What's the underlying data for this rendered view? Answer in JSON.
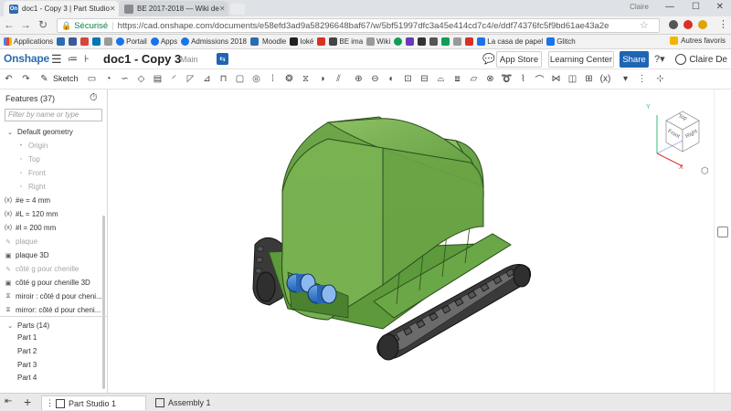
{
  "browser": {
    "tabs": [
      {
        "title": "doc1 - Copy 3 | Part Studio",
        "active": true
      },
      {
        "title": "BE 2017-2018 — Wiki de",
        "active": false
      }
    ],
    "window_user": "Claire",
    "security_label": "Sécurisé",
    "url": "https://cad.onshape.com/documents/e58efd3ad9a58296648baf67/w/5bf51997dfc3a45e414cd7c4/e/ddf74376fc5f9bd61ae43a2e"
  },
  "bookmarks": {
    "items": [
      "Applications",
      "Portail",
      "Apps",
      "Admissions 2018",
      "Moodle",
      "Ioké",
      "BE ima",
      "Wiki",
      "La casa de papel",
      "Glitch"
    ],
    "other": "Autres favoris"
  },
  "onshape": {
    "logo": "Onshape",
    "sketch_label": "Sketch",
    "doc_title": "doc1 - Copy 3",
    "branch": "Main",
    "app_store": "App Store",
    "learning_center": "Learning Center",
    "share": "Share",
    "user_name": "Claire De"
  },
  "features": {
    "header": "Features (37)",
    "filter_placeholder": "Filter by name or type",
    "default_geometry": "Default geometry",
    "origin": "Origin",
    "top": "Top",
    "front": "Front",
    "right": "Right",
    "var1": "#e = 4 mm",
    "var2": "#L = 120 mm",
    "var3": "#l = 200 mm",
    "f1": "plaque",
    "f2": "plaque 3D",
    "f3": "côté g pour chenille",
    "f4": "côté g pour chenille 3D",
    "f5": "miroir : côté d pour cheni...",
    "f6": "mirror: côté d pour cheni..."
  },
  "parts": {
    "header": "Parts (14)",
    "items": [
      "Part 1",
      "Part 2",
      "Part 3",
      "Part 4"
    ]
  },
  "view_cube": {
    "top": "Top",
    "front": "Front",
    "right": "Right"
  },
  "bottom_tabs": {
    "part_studio": "Part Studio 1",
    "assembly": "Assembly 1"
  },
  "colors": {
    "onshape_blue": "#1f65b3",
    "model_green": "#6fa84a"
  }
}
